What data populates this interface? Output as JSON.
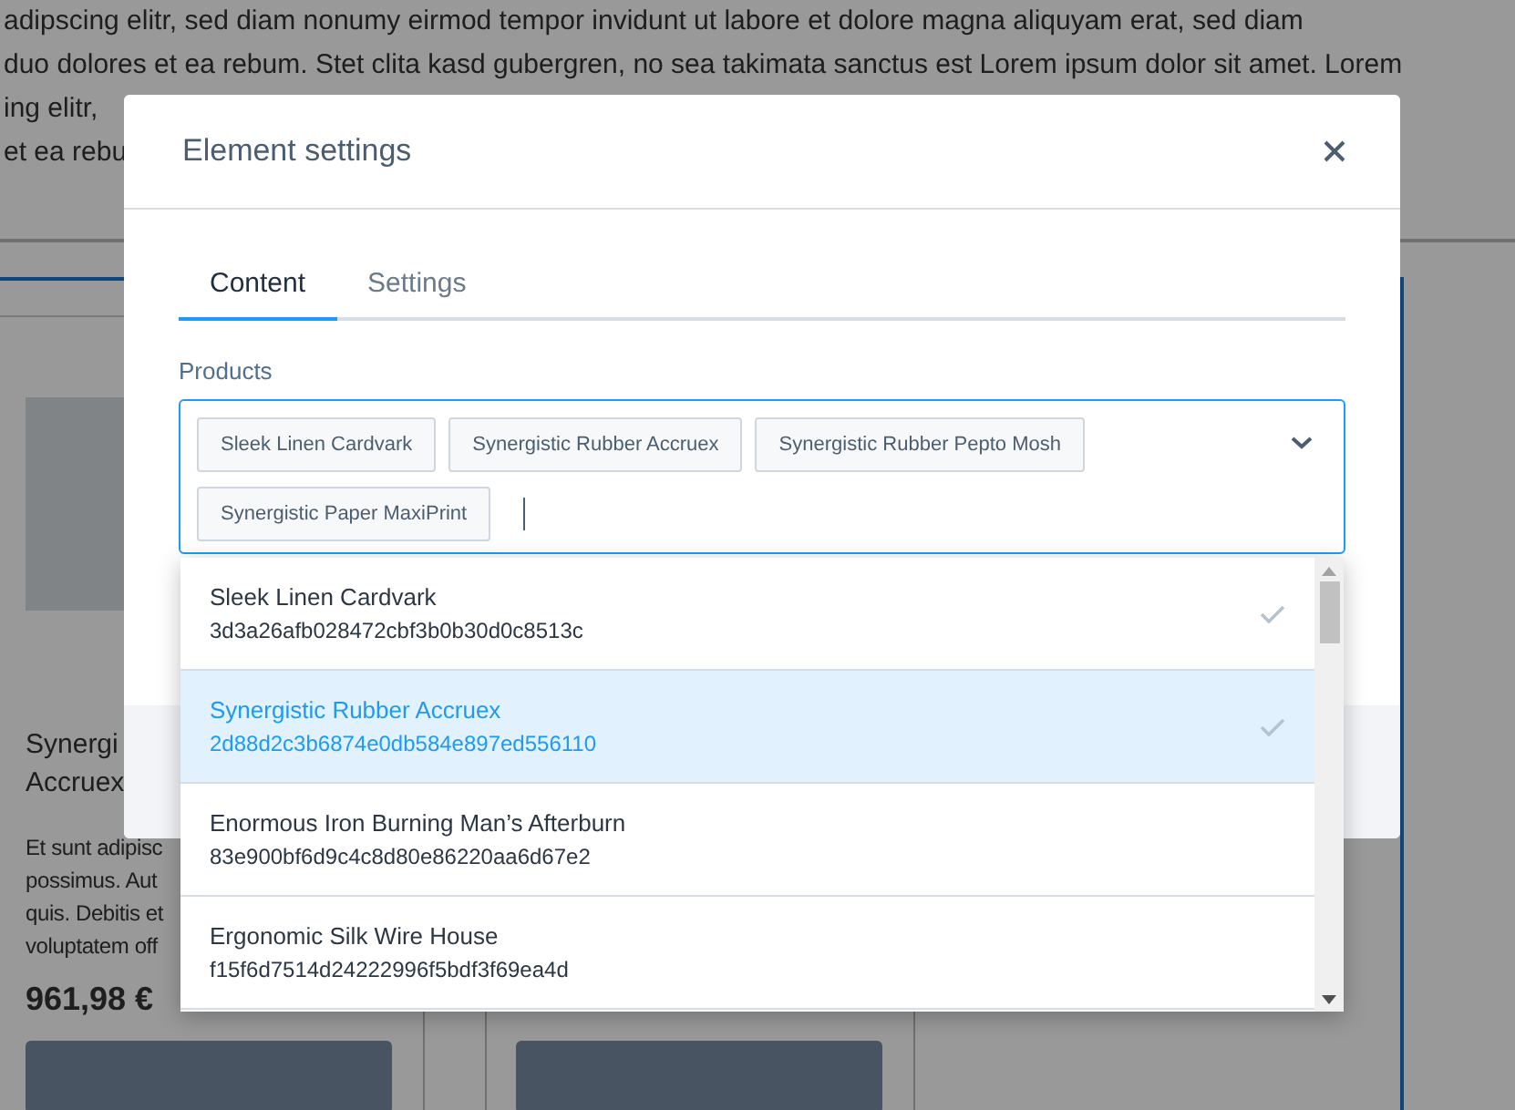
{
  "background": {
    "paragraph_lines": [
      "adipscing elitr, sed diam nonumy eirmod tempor invidunt ut labore et dolore magna aliquyam erat, sed diam",
      "duo dolores et ea rebum. Stet clita kasd gubergren, no sea takimata sanctus est Lorem ipsum dolor sit amet. Lorem",
      "ing elitr,",
      "et ea rebu"
    ],
    "cards": [
      {
        "title_lines": [
          "Synergi",
          "Accruex"
        ],
        "description_lines": [
          "Et sunt adipisc",
          "possimus. Aut",
          "quis. Debitis et",
          "voluptatem off"
        ],
        "price": "961,98 €"
      }
    ]
  },
  "modal": {
    "title": "Element settings",
    "tabs": [
      {
        "label": "Content",
        "selected": true
      },
      {
        "label": "Settings",
        "selected": false
      }
    ],
    "field_label": "Products",
    "chips": [
      "Sleek Linen Cardvark",
      "Synergistic Rubber Accruex",
      "Synergistic Rubber Pepto Mosh",
      "Synergistic Paper MaxiPrint"
    ],
    "options": [
      {
        "name": "Sleek Linen Cardvark",
        "id": "3d3a26afb028472cbf3b0b30d0c8513c",
        "checked": true,
        "highlighted": false
      },
      {
        "name": "Synergistic Rubber Accruex",
        "id": "2d88d2c3b6874e0db584e897ed556110",
        "checked": true,
        "highlighted": true
      },
      {
        "name": "Enormous Iron Burning Man’s Afterburn",
        "id": "83e900bf6d9c4c8d80e86220aa6d67e2",
        "checked": false,
        "highlighted": false
      },
      {
        "name": "Ergonomic Silk Wire House",
        "id": "f15f6d7514d24222996f5bdf3f69ea4d",
        "checked": false,
        "highlighted": false
      }
    ]
  }
}
